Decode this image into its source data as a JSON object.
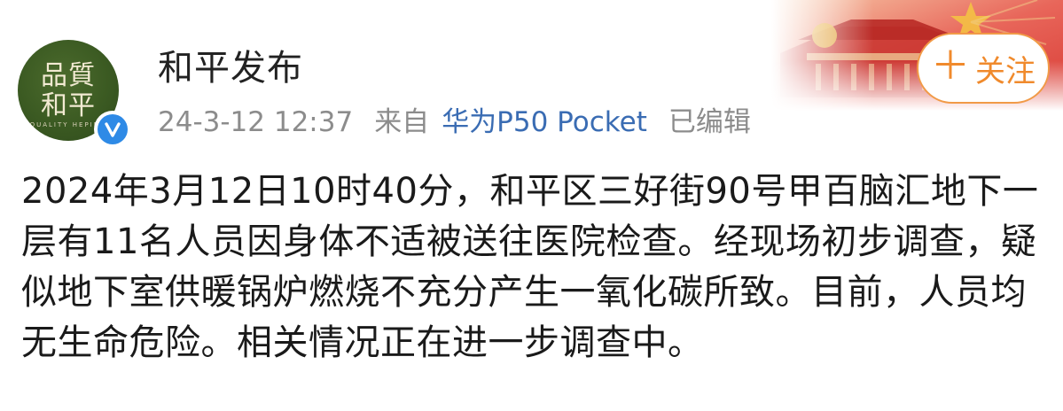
{
  "user": {
    "name": "和平发布",
    "avatar_text": "品質和平"
  },
  "meta": {
    "timestamp": "24-3-12 12:37",
    "source_prefix": "来自",
    "device": "华为P50 Pocket",
    "edited": "已编辑"
  },
  "follow": {
    "label": "关注",
    "plus": "＋"
  },
  "post": {
    "text": "2024年3月12日10时40分，和平区三好街90号甲百脑汇地下一层有11名人员因身体不适被送往医院检查。经现场初步调查，疑似地下室供暖锅炉燃烧不充分产生一氧化碳所致。目前，人员均无生命危险。相关情况正在进一步调查中。"
  },
  "colors": {
    "accent_orange": "#f08a2c",
    "link_blue": "#3a6cb3",
    "verify_blue": "#2e8ae6",
    "avatar_green": "#3b5a22",
    "meta_gray": "#8c8c8c"
  },
  "icons": {
    "verify": "verified-v-icon",
    "banner": "tiananmen-banner-image"
  }
}
